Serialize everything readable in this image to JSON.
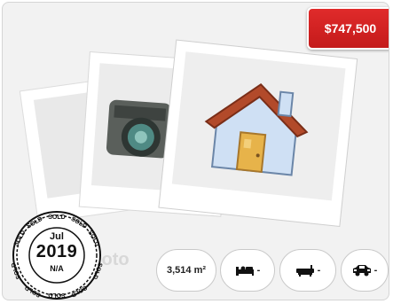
{
  "listing": {
    "price": "$747,500",
    "placeholder_watermark": "Photo"
  },
  "sold_stamp": {
    "ring_word": "SOLD",
    "month": "Jul",
    "year": "2019",
    "status": "N/A"
  },
  "features": {
    "land_area": "3,514 m²",
    "bedrooms": "-",
    "bathrooms": "-",
    "car_spaces": "-"
  },
  "icons": {
    "bed": "bed-icon",
    "bath": "bath-icon",
    "car": "car-icon",
    "camera": "camera-icon",
    "house": "house-icon"
  },
  "colors": {
    "price_badge": "#d42020",
    "stamp_ink": "#111111"
  }
}
